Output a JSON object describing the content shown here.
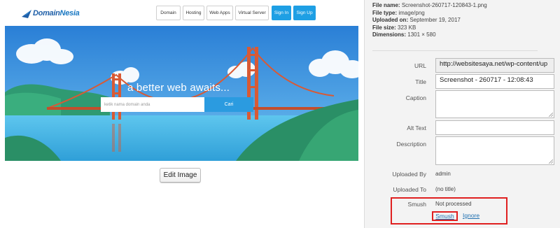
{
  "site": {
    "logo_text_a": "Domain",
    "logo_text_b": "Nesia",
    "nav": [
      "Domain",
      "Hosting",
      "Web Apps",
      "Virtual Server"
    ],
    "signin": "Sign In",
    "signup": "Sign Up",
    "hero_heading": "a better web awaits...",
    "search_placeholder": "ketik nama domain anda",
    "search_button": "Cari",
    "colors": {
      "brand_blue": "#1e9fe4",
      "sky": "#2f86d8"
    }
  },
  "edit_image_label": "Edit Image",
  "meta": {
    "file_name_label": "File name:",
    "file_name": "Screenshot-260717-120843-1.png",
    "file_type_label": "File type:",
    "file_type": "image/png",
    "uploaded_on_label": "Uploaded on:",
    "uploaded_on": "September 19, 2017",
    "file_size_label": "File size:",
    "file_size": "323 KB",
    "dimensions_label": "Dimensions:",
    "dimensions": "1301 × 580"
  },
  "fields": {
    "url_label": "URL",
    "url_value": "http://websitesaya.net/wp-content/up",
    "title_label": "Title",
    "title_value": "Screenshot - 260717 - 12:08:43",
    "caption_label": "Caption",
    "caption_value": "",
    "alt_label": "Alt Text",
    "alt_value": "",
    "description_label": "Description",
    "description_value": "",
    "uploaded_by_label": "Uploaded By",
    "uploaded_by_value": "admin",
    "uploaded_to_label": "Uploaded To",
    "uploaded_to_value": "(no title)"
  },
  "smush": {
    "label": "Smush",
    "status": "Not processed",
    "smush_link": "Smush",
    "ignore_link": "Ignore",
    "highlight_color": "#e02020"
  }
}
